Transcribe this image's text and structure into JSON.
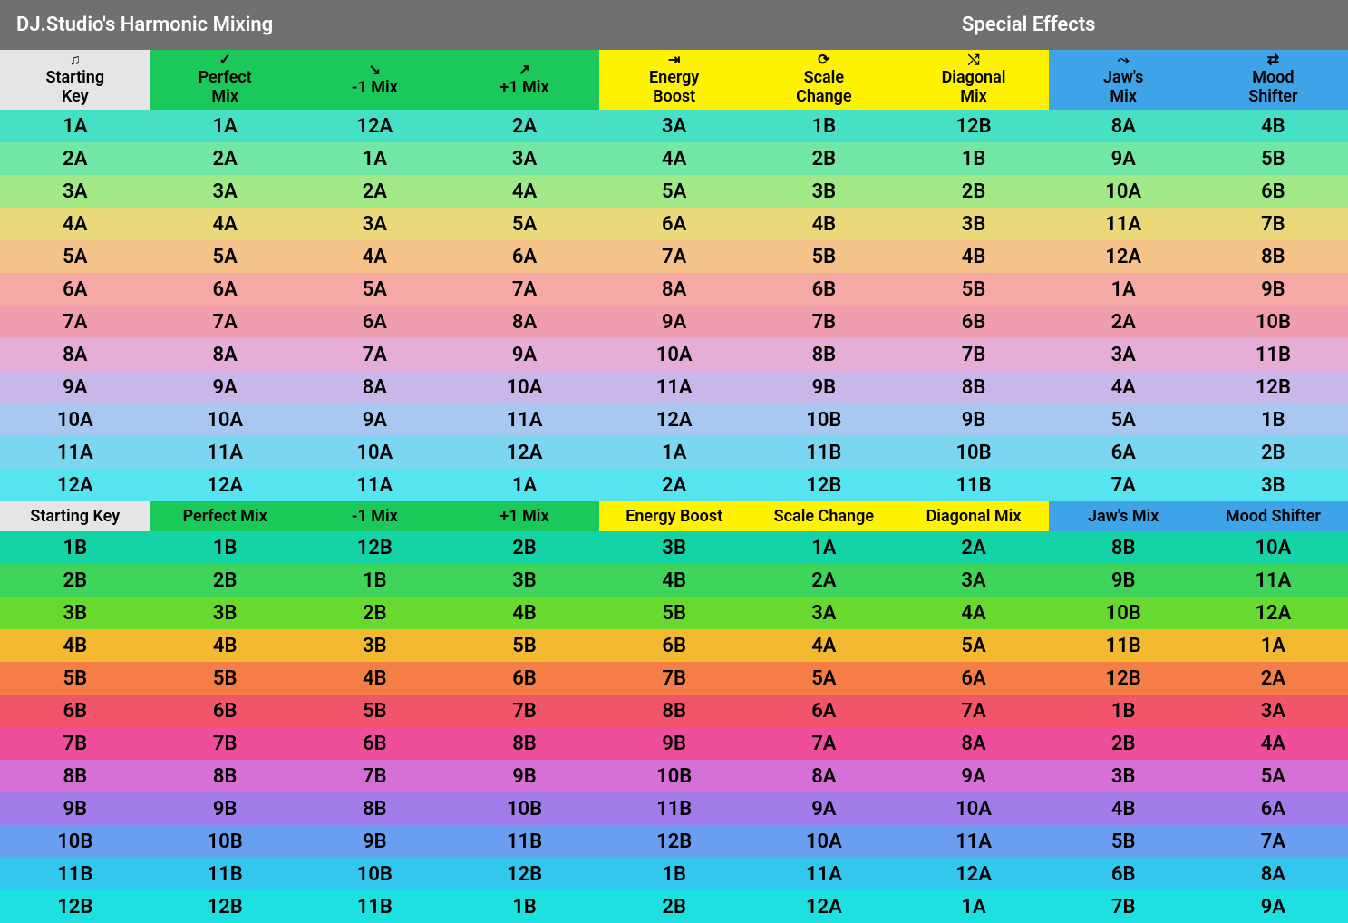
{
  "title": "DJ.Studio's Harmonic Mixing",
  "specialTitle": "Special Effects",
  "columns": [
    {
      "label": "Starting\nKey",
      "icon": "♫",
      "cls": "bg-key"
    },
    {
      "label": "Perfect\nMix",
      "icon": "✓",
      "cls": "bg-green"
    },
    {
      "label": "-1 Mix",
      "icon": "↘",
      "cls": "bg-green"
    },
    {
      "label": "+1 Mix",
      "icon": "↗",
      "cls": "bg-green"
    },
    {
      "label": "Energy\nBoost",
      "icon": "⇥",
      "cls": "bg-yellow"
    },
    {
      "label": "Scale\nChange",
      "icon": "⟳",
      "cls": "bg-yellow"
    },
    {
      "label": "Diagonal\nMix",
      "icon": "⤭",
      "cls": "bg-yellow"
    },
    {
      "label": "Jaw's\nMix",
      "icon": "⤳",
      "cls": "bg-blue"
    },
    {
      "label": "Mood\nShifter",
      "icon": "⇄",
      "cls": "bg-blue"
    }
  ],
  "subColumns": [
    "Starting Key",
    "Perfect Mix",
    "-1 Mix",
    "+1 Mix",
    "Energy Boost",
    "Scale Change",
    "Diagonal Mix",
    "Jaw's Mix",
    "Mood Shifter"
  ],
  "rowColorsA": [
    "#46e0c4",
    "#72e6a5",
    "#a1e986",
    "#e9d97a",
    "#f5c28a",
    "#f6a8a4",
    "#f19db0",
    "#e6aed6",
    "#c9b7ea",
    "#a9c8f1",
    "#7bd6f2",
    "#56e5f0"
  ],
  "rowColorsB": [
    "#14d3a6",
    "#3ed55a",
    "#68d92e",
    "#f3b930",
    "#f47e46",
    "#f2556b",
    "#ef4f9a",
    "#d66fd6",
    "#a27ce9",
    "#6a9ef0",
    "#34c7ee",
    "#1fe0e0"
  ],
  "sectionA": [
    [
      "1A",
      "1A",
      "12A",
      "2A",
      "3A",
      "1B",
      "12B",
      "8A",
      "4B"
    ],
    [
      "2A",
      "2A",
      "1A",
      "3A",
      "4A",
      "2B",
      "1B",
      "9A",
      "5B"
    ],
    [
      "3A",
      "3A",
      "2A",
      "4A",
      "5A",
      "3B",
      "2B",
      "10A",
      "6B"
    ],
    [
      "4A",
      "4A",
      "3A",
      "5A",
      "6A",
      "4B",
      "3B",
      "11A",
      "7B"
    ],
    [
      "5A",
      "5A",
      "4A",
      "6A",
      "7A",
      "5B",
      "4B",
      "12A",
      "8B"
    ],
    [
      "6A",
      "6A",
      "5A",
      "7A",
      "8A",
      "6B",
      "5B",
      "1A",
      "9B"
    ],
    [
      "7A",
      "7A",
      "6A",
      "8A",
      "9A",
      "7B",
      "6B",
      "2A",
      "10B"
    ],
    [
      "8A",
      "8A",
      "7A",
      "9A",
      "10A",
      "8B",
      "7B",
      "3A",
      "11B"
    ],
    [
      "9A",
      "9A",
      "8A",
      "10A",
      "11A",
      "9B",
      "8B",
      "4A",
      "12B"
    ],
    [
      "10A",
      "10A",
      "9A",
      "11A",
      "12A",
      "10B",
      "9B",
      "5A",
      "1B"
    ],
    [
      "11A",
      "11A",
      "10A",
      "12A",
      "1A",
      "11B",
      "10B",
      "6A",
      "2B"
    ],
    [
      "12A",
      "12A",
      "11A",
      "1A",
      "2A",
      "12B",
      "11B",
      "7A",
      "3B"
    ]
  ],
  "sectionB": [
    [
      "1B",
      "1B",
      "12B",
      "2B",
      "3B",
      "1A",
      "2A",
      "8B",
      "10A"
    ],
    [
      "2B",
      "2B",
      "1B",
      "3B",
      "4B",
      "2A",
      "3A",
      "9B",
      "11A"
    ],
    [
      "3B",
      "3B",
      "2B",
      "4B",
      "5B",
      "3A",
      "4A",
      "10B",
      "12A"
    ],
    [
      "4B",
      "4B",
      "3B",
      "5B",
      "6B",
      "4A",
      "5A",
      "11B",
      "1A"
    ],
    [
      "5B",
      "5B",
      "4B",
      "6B",
      "7B",
      "5A",
      "6A",
      "12B",
      "2A"
    ],
    [
      "6B",
      "6B",
      "5B",
      "7B",
      "8B",
      "6A",
      "7A",
      "1B",
      "3A"
    ],
    [
      "7B",
      "7B",
      "6B",
      "8B",
      "9B",
      "7A",
      "8A",
      "2B",
      "4A"
    ],
    [
      "8B",
      "8B",
      "7B",
      "9B",
      "10B",
      "8A",
      "9A",
      "3B",
      "5A"
    ],
    [
      "9B",
      "9B",
      "8B",
      "10B",
      "11B",
      "9A",
      "10A",
      "4B",
      "6A"
    ],
    [
      "10B",
      "10B",
      "9B",
      "11B",
      "12B",
      "10A",
      "11A",
      "5B",
      "7A"
    ],
    [
      "11B",
      "11B",
      "10B",
      "12B",
      "1B",
      "11A",
      "12A",
      "6B",
      "8A"
    ],
    [
      "12B",
      "12B",
      "11B",
      "1B",
      "2B",
      "12A",
      "1A",
      "7B",
      "9A"
    ]
  ]
}
